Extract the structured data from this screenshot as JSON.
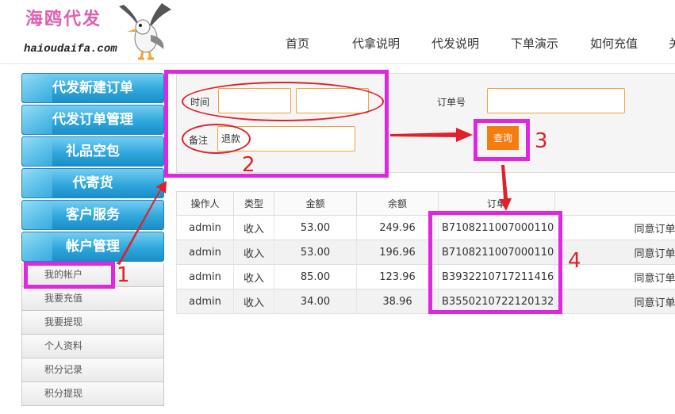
{
  "header": {
    "logo_cn": "海鸥代发",
    "logo_en": "haioudaifa.com",
    "nav": [
      "首页",
      "代拿说明",
      "代发说明",
      "下单演示",
      "如何充值",
      "关"
    ]
  },
  "sidebar": {
    "main": [
      "代发新建订单",
      "代发订单管理",
      "礼品空包",
      "代寄货",
      "客户服务",
      "帐户管理"
    ],
    "sub": [
      "我的帐户",
      "我要充值",
      "我要提现",
      "个人资料",
      "积分记录",
      "积分提现"
    ]
  },
  "search": {
    "time_label": "时间",
    "time_from": "",
    "time_to": "",
    "order_label": "订单号",
    "order_value": "",
    "note_label": "备注",
    "note_value": "退款",
    "button": "查询"
  },
  "table": {
    "headers": [
      "操作人",
      "类型",
      "金额",
      "余额",
      "订单",
      ""
    ],
    "rows": [
      {
        "op": "admin",
        "type": "收入",
        "amount": "53.00",
        "balance": "249.96",
        "order": "B7108211007000110",
        "note": "同意订单"
      },
      {
        "op": "admin",
        "type": "收入",
        "amount": "53.00",
        "balance": "196.96",
        "order": "B7108211007000110",
        "note": "同意订单"
      },
      {
        "op": "admin",
        "type": "收入",
        "amount": "85.00",
        "balance": "123.96",
        "order": "B3932210717211416",
        "note": "同意订单"
      },
      {
        "op": "admin",
        "type": "收入",
        "amount": "34.00",
        "balance": "38.96",
        "order": "B3550210722120132",
        "note": "同意订单"
      }
    ]
  },
  "annotations": {
    "n1": "1",
    "n2": "2",
    "n3": "3",
    "n4": "4",
    "box_color": "#e027e0",
    "arrow_color": "#e0202a"
  }
}
